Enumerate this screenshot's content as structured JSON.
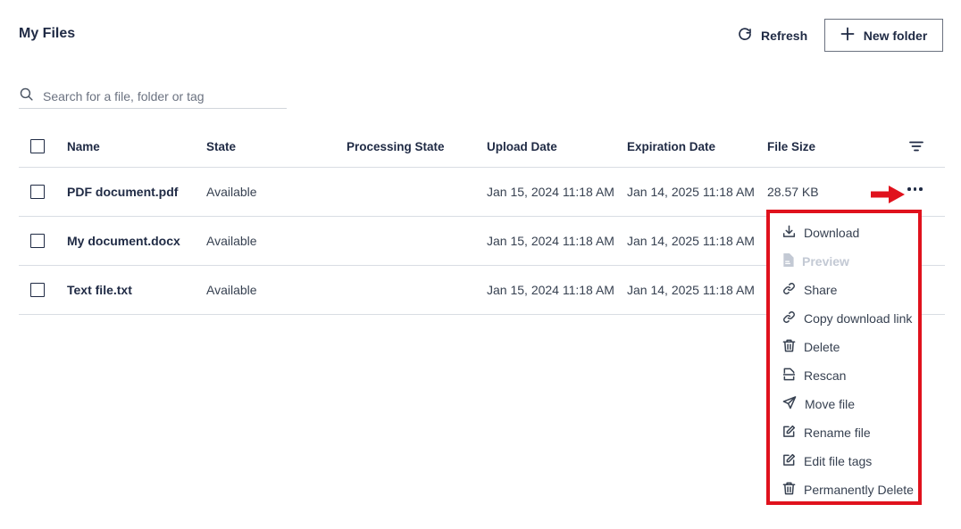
{
  "header": {
    "title": "My Files",
    "refresh_label": "Refresh",
    "new_folder_label": "New folder"
  },
  "search": {
    "placeholder": "Search for a file, folder or tag",
    "value": ""
  },
  "table": {
    "columns": {
      "name": "Name",
      "state": "State",
      "processing_state": "Processing State",
      "upload_date": "Upload Date",
      "expiration_date": "Expiration Date",
      "file_size": "File Size"
    },
    "rows": [
      {
        "name": "PDF document.pdf",
        "state": "Available",
        "processing_state": "",
        "upload_date": "Jan 15, 2024 11:18 AM",
        "expiration_date": "Jan 14, 2025 11:18 AM",
        "file_size": "28.57 KB"
      },
      {
        "name": "My document.docx",
        "state": "Available",
        "processing_state": "",
        "upload_date": "Jan 15, 2024 11:18 AM",
        "expiration_date": "Jan 14, 2025 11:18 AM",
        "file_size": ""
      },
      {
        "name": "Text file.txt",
        "state": "Available",
        "processing_state": "",
        "upload_date": "Jan 15, 2024 11:18 AM",
        "expiration_date": "Jan 14, 2025 11:18 AM",
        "file_size": ""
      }
    ]
  },
  "context_menu": {
    "items": [
      {
        "label": "Download",
        "icon": "download-icon",
        "disabled": false
      },
      {
        "label": "Preview",
        "icon": "file-icon",
        "disabled": true
      },
      {
        "label": "Share",
        "icon": "link-icon",
        "disabled": false
      },
      {
        "label": "Copy download link",
        "icon": "link-icon",
        "disabled": false
      },
      {
        "label": "Delete",
        "icon": "trash-icon",
        "disabled": false
      },
      {
        "label": "Rescan",
        "icon": "scan-icon",
        "disabled": false
      },
      {
        "label": "Move file",
        "icon": "send-icon",
        "disabled": false
      },
      {
        "label": "Rename file",
        "icon": "edit-icon",
        "disabled": false
      },
      {
        "label": "Edit file tags",
        "icon": "edit-icon",
        "disabled": false
      },
      {
        "label": "Permanently Delete",
        "icon": "trash-icon",
        "disabled": false
      }
    ]
  },
  "colors": {
    "text": "#1f2a44",
    "highlight": "#e0121d",
    "disabled": "#c3c9d4"
  }
}
